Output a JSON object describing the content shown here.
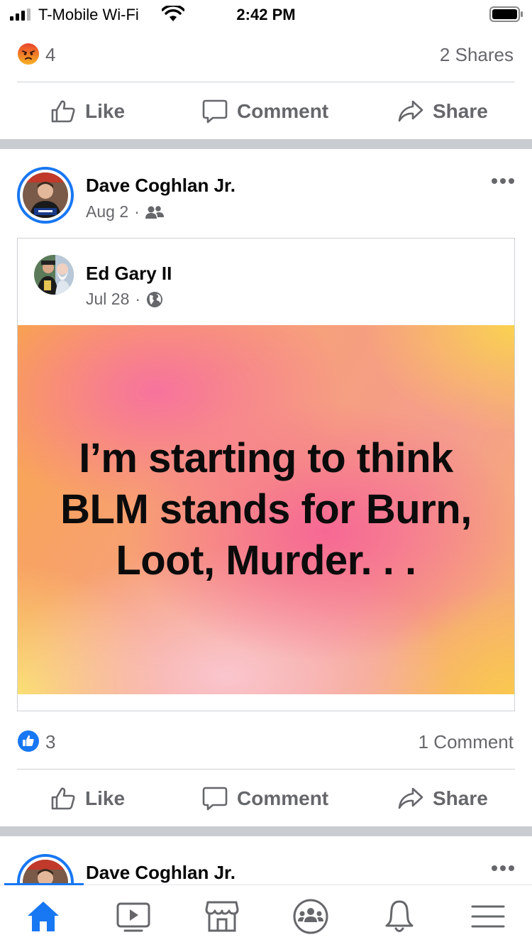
{
  "status_bar": {
    "carrier": "T-Mobile Wi-Fi",
    "time": "2:42 PM"
  },
  "prev_post": {
    "reaction": "angry",
    "reaction_count": "4",
    "shares": "2 Shares"
  },
  "actions": {
    "like": "Like",
    "comment": "Comment",
    "share": "Share"
  },
  "post": {
    "author": "Dave Coghlan Jr.",
    "date": "Aug 2",
    "audience_icon": "friends-icon",
    "shared": {
      "author": "Ed Gary II",
      "date": "Jul 28",
      "audience_icon": "globe-icon",
      "text": "I’m starting to think BLM stands for Burn, Loot, Murder. . ."
    },
    "reaction": "like",
    "reaction_count": "3",
    "comments": "1 Comment"
  },
  "next_post": {
    "author": "Dave Coghlan Jr."
  },
  "bottom_nav": [
    "home-icon",
    "watch-icon",
    "marketplace-icon",
    "groups-icon",
    "notifications-icon",
    "menu-icon"
  ],
  "colors": {
    "accent": "#1877f2",
    "secondary_text": "#65676b",
    "divider_band": "#c9ccd1"
  }
}
